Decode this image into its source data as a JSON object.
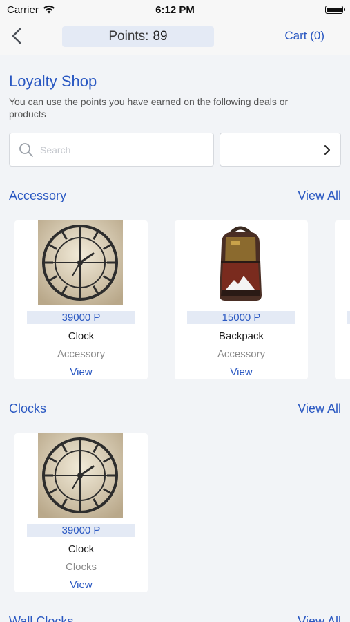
{
  "status_bar": {
    "carrier": "Carrier",
    "time": "6:12 PM"
  },
  "nav": {
    "points_label": "Points:",
    "points_value": "89",
    "cart_label": "Cart (0)"
  },
  "page": {
    "title": "Loyalty Shop",
    "subtitle": "You can use the points you have earned on the following deals or products"
  },
  "search": {
    "placeholder": "Search",
    "value": ""
  },
  "filter": {
    "selected": ""
  },
  "sections": [
    {
      "title": "Accessory",
      "view_all": "View All",
      "items": [
        {
          "price": "39000 P",
          "name": "Clock",
          "category": "Accessory",
          "action": "View",
          "image": "clock-image"
        },
        {
          "price": "15000 P",
          "name": "Backpack",
          "category": "Accessory",
          "action": "View",
          "image": "backpack-image"
        }
      ]
    },
    {
      "title": "Clocks",
      "view_all": "View All",
      "items": [
        {
          "price": "39000 P",
          "name": "Clock",
          "category": "Clocks",
          "action": "View",
          "image": "clock-image"
        }
      ]
    },
    {
      "title": "Wall Clocks",
      "view_all": "View All",
      "items": []
    }
  ],
  "colors": {
    "accent": "#2a58c2",
    "price_bg": "#e4eaf5",
    "page_bg": "#f2f4f7"
  }
}
